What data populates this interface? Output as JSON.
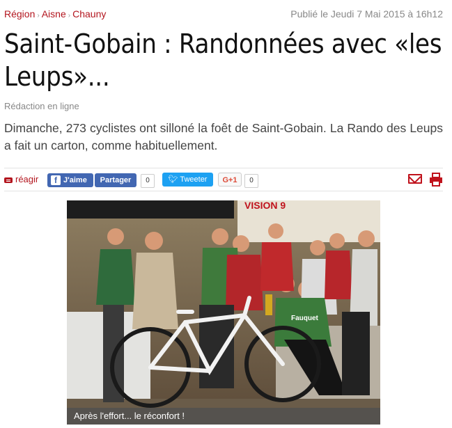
{
  "breadcrumb": {
    "items": [
      "Région",
      "Aisne",
      "Chauny"
    ],
    "separator": "›"
  },
  "published": "Publié le Jeudi 7 Mai 2015 à 16h12",
  "article": {
    "title": "Saint-Gobain : Randonnées avec «les Leups»...",
    "author": "Rédaction en ligne",
    "chapo": "Dimanche, 273 cyclistes ont silloné la foêt de Saint-Gobain. La Rando des Leups a fait un carton, comme habituellement."
  },
  "share": {
    "react_label": "réagir",
    "fb_like_label": "J'aime",
    "fb_share_label": "Partager",
    "fb_count": "0",
    "tweet_label": "Tweeter",
    "gplus_label": "G+1",
    "gplus_count": "0",
    "accent_color": "#b3151e"
  },
  "photo": {
    "caption": "Après l'effort... le réconfort !",
    "banner_text": "VISION 9",
    "jersey_text": "Fauquet"
  }
}
